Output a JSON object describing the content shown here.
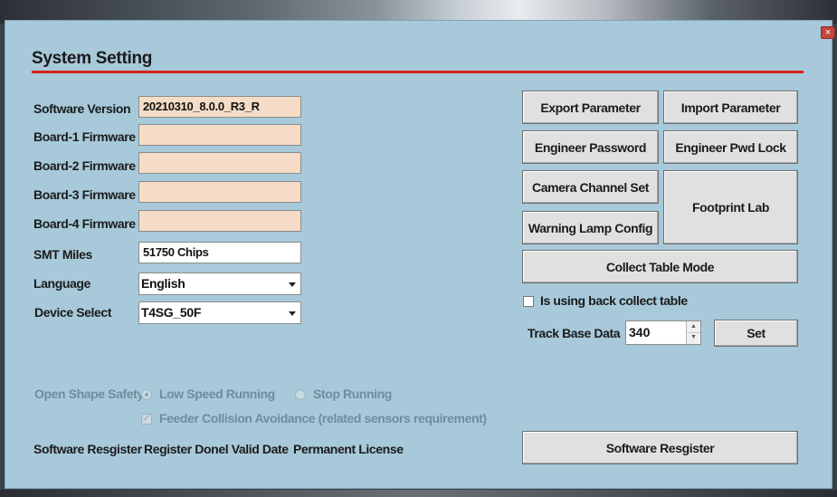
{
  "window": {
    "title": "System Setting",
    "close_glyph": "×"
  },
  "versions": [
    {
      "label": "Software Version",
      "value": "20210310_8.0.0_R3_R"
    },
    {
      "label": "Board-1 Firmware",
      "value": ""
    },
    {
      "label": "Board-2 Firmware",
      "value": ""
    },
    {
      "label": "Board-3 Firmware",
      "value": ""
    },
    {
      "label": "Board-4 Firmware",
      "value": ""
    }
  ],
  "smt_miles": {
    "label": "SMT Miles",
    "value": "51750 Chips"
  },
  "language": {
    "label": "Language",
    "selected": "English"
  },
  "device": {
    "label": "Device Select",
    "selected": "T4SG_50F"
  },
  "buttons": {
    "export_parameter": "Export Parameter",
    "import_parameter": "Import Parameter",
    "engineer_password": "Engineer Password",
    "engineer_pwd_lock": "Engineer Pwd Lock",
    "camera_channel_set": "Camera Channel Set",
    "footprint_lab": "Footprint Lab",
    "warning_lamp_config": "Warning Lamp Config",
    "collect_table_mode": "Collect Table Mode",
    "set": "Set",
    "software_register": "Software Resgister"
  },
  "back_collect": {
    "label": "Is using back collect table",
    "checked": false
  },
  "track_base": {
    "label": "Track Base Data",
    "value": "340"
  },
  "open_shape": {
    "label": "Open Shape Safety",
    "low_speed": "Low Speed Running",
    "stop_running": "Stop Running",
    "selected": "Low Speed Running",
    "feeder_collision": "Feeder Collision Avoidance (related sensors requirement)",
    "feeder_checked": true
  },
  "register": {
    "label": "Software Resgister",
    "register_done": "Register Donel Valid Date",
    "license": "Permanent License"
  },
  "colors": {
    "panel_bg": "#a7c9da",
    "title_rule": "#d8221a",
    "readonly_field": "#f4dcc6"
  }
}
